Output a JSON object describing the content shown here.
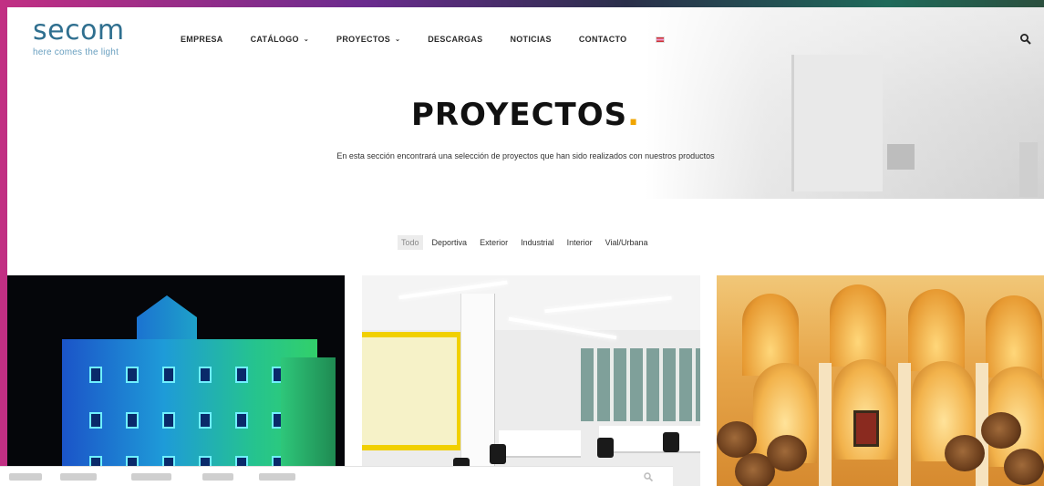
{
  "logo": {
    "word": "secom",
    "tagline": "here comes the light"
  },
  "nav": {
    "items": [
      {
        "label": "EMPRESA",
        "has_dropdown": false
      },
      {
        "label": "CATÁLOGO",
        "has_dropdown": true
      },
      {
        "label": "PROYECTOS",
        "has_dropdown": true
      },
      {
        "label": "DESCARGAS",
        "has_dropdown": false
      },
      {
        "label": "NOTICIAS",
        "has_dropdown": false
      },
      {
        "label": "CONTACTO",
        "has_dropdown": false
      }
    ],
    "dropdown_glyph": "⌄",
    "language_flag": "uk-flag-icon",
    "search_icon": "search-icon"
  },
  "hero": {
    "title": "PROYECTOS",
    "title_dot": ".",
    "subtitle": "En esta sección encontrará una selección de proyectos que han sido realizados con nuestros productos"
  },
  "filters": {
    "items": [
      "Todo",
      "Deportiva",
      "Exterior",
      "Industrial",
      "Interior",
      "Vial/Urbana"
    ],
    "active": "Todo"
  },
  "projects": [
    {
      "image": "illuminated-building-image"
    },
    {
      "image": "office-interior-image"
    },
    {
      "image": "wine-cellar-image"
    }
  ],
  "colors": {
    "brand_blue": "#2f6f8f",
    "accent_dot": "#f0a500",
    "text_dark": "#111111"
  }
}
